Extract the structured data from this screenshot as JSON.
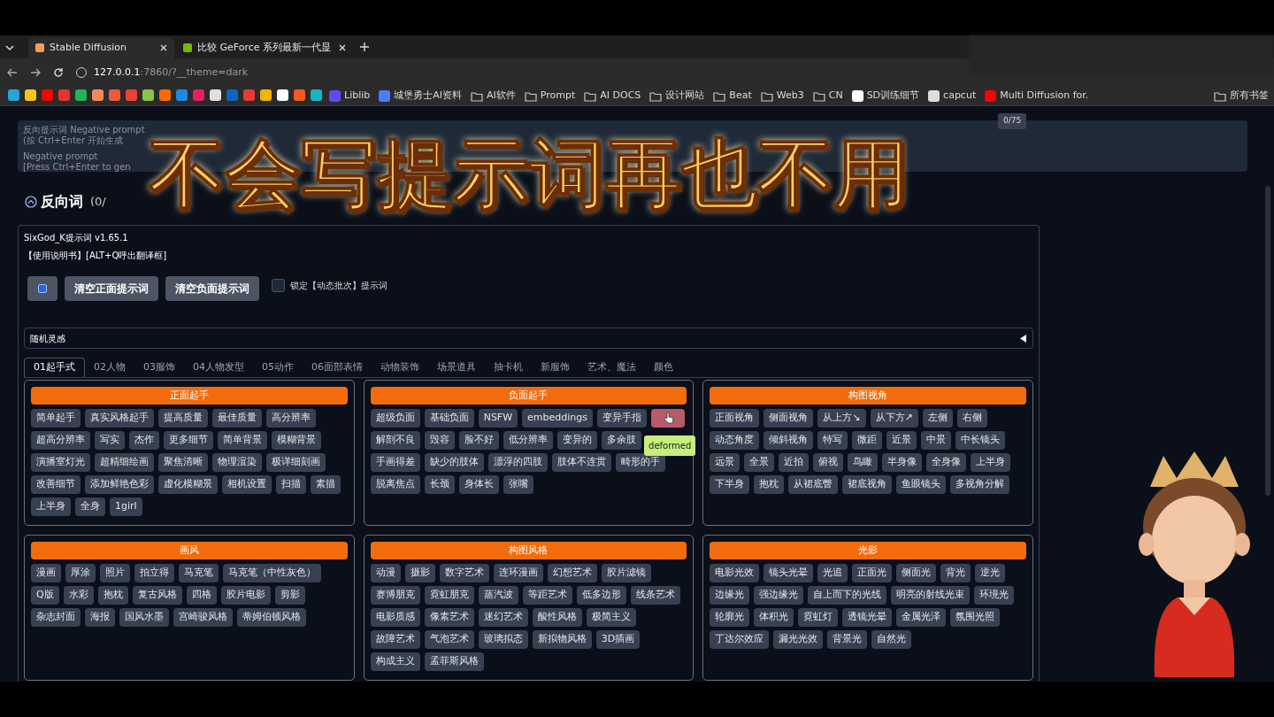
{
  "browser": {
    "tabs": [
      {
        "title": "Stable Diffusion",
        "selected": true
      },
      {
        "title": "比较 GeForce 系列最新一代显",
        "selected": false
      }
    ],
    "address": {
      "host": "127.0.0.1",
      "rest": ":7860/?__theme=dark"
    },
    "bookmarks": [
      {
        "kind": "icon",
        "color": "#29a3d8"
      },
      {
        "kind": "icon",
        "color": "#f5c518"
      },
      {
        "kind": "icon",
        "color": "#ff0000"
      },
      {
        "kind": "icon",
        "color": "#e5352b"
      },
      {
        "kind": "icon",
        "color": "#22b455"
      },
      {
        "kind": "icon",
        "color": "#f08a5d"
      },
      {
        "kind": "icon",
        "color": "#ef5b3a"
      },
      {
        "kind": "icon",
        "color": "#ea4335"
      },
      {
        "kind": "icon",
        "color": "#8bc34a"
      },
      {
        "kind": "icon",
        "color": "#ff6a00"
      },
      {
        "kind": "icon",
        "color": "#1e88e5"
      },
      {
        "kind": "icon",
        "color": "#e91e63"
      },
      {
        "kind": "icon",
        "color": "#e0e0e0"
      },
      {
        "kind": "icon",
        "color": "#0a66c2"
      },
      {
        "kind": "icon",
        "color": "#e53935"
      },
      {
        "kind": "icon",
        "color": "#f0b400"
      },
      {
        "kind": "icon",
        "color": "#ffffff"
      },
      {
        "kind": "icon",
        "color": "#ff5722"
      },
      {
        "kind": "icon",
        "color": "#19b3c2"
      },
      {
        "kind": "site",
        "color": "#5b4bff",
        "label": "Liblib"
      },
      {
        "kind": "site",
        "color": "#4f7cff",
        "label": "城堡勇士AI资料"
      },
      {
        "kind": "folder",
        "label": "AI软件"
      },
      {
        "kind": "folder",
        "label": "Prompt"
      },
      {
        "kind": "folder",
        "label": "AI DOCS"
      },
      {
        "kind": "folder",
        "label": "设计网站"
      },
      {
        "kind": "folder",
        "label": "Beat"
      },
      {
        "kind": "folder",
        "label": "Web3"
      },
      {
        "kind": "folder",
        "label": "CN"
      },
      {
        "kind": "site",
        "color": "#ffffff",
        "label": "SD训练细节"
      },
      {
        "kind": "site",
        "color": "#dddddd",
        "label": "capcut"
      },
      {
        "kind": "site",
        "color": "#ff0000",
        "label": "Multi Diffusion for."
      }
    ],
    "all_bookmarks": "所有书签"
  },
  "negative_prompt": {
    "placeholder_lines": [
      "反向提示词 Negative prompt",
      "(按 Ctrl+Enter 开始生成",
      "Negative prompt",
      "[Press Ctrl+Enter to gen"
    ],
    "counter": "0/75"
  },
  "section_heading": "反向词",
  "section_count": "(0/",
  "overlay_title": "不会写提示词再也不用",
  "plugin": {
    "version": "SixGod_K提示词 v1.65.1",
    "manual": "【使用说明书】[ALT+Q呼出翻译框]",
    "clear_positive": "清空正面提示词",
    "clear_negative": "清空负面提示词",
    "lock": {
      "label": "锁定【动态批次】提示词",
      "checked": false
    },
    "random": {
      "label": "随机灵感",
      "expanded": false
    },
    "tabs": [
      {
        "label": "01起手式",
        "selected": true
      },
      {
        "label": "02人物",
        "selected": false
      },
      {
        "label": "03服饰",
        "selected": false
      },
      {
        "label": "04人物发型",
        "selected": false
      },
      {
        "label": "05动作",
        "selected": false
      },
      {
        "label": "06面部表情",
        "selected": false
      },
      {
        "label": "动物装饰",
        "selected": false
      },
      {
        "label": "场景道具",
        "selected": false
      },
      {
        "label": "抽卡机",
        "selected": false
      },
      {
        "label": "新服饰",
        "selected": false
      },
      {
        "label": "艺术、魔法",
        "selected": false
      },
      {
        "label": "颜色",
        "selected": false
      }
    ],
    "cards": [
      {
        "title": "正面起手",
        "chips": [
          "简单起手",
          "真实风格起手",
          "提高质量",
          "最佳质量",
          "高分辨率",
          "超高分辨率",
          "写实",
          "杰作",
          "更多细节",
          "简单背景",
          "模糊背景",
          "演播室灯光",
          "超精细绘画",
          "聚焦清晰",
          "物理渲染",
          "极详细刻画",
          "改善细节",
          "添加鲜艳色彩",
          "虚化模糊景",
          "相机设置",
          "扫描",
          "素描",
          "上半身",
          "全身",
          "1girl"
        ]
      },
      {
        "title": "负面起手",
        "chips": [
          "超级负面",
          "基础负面",
          "NSFW",
          "embeddings",
          "变异手指",
          {
            "kind": "hovered"
          },
          "解剖不良",
          "毁容",
          "脸不好",
          "低分辨率",
          "变异的",
          "多余肢",
          "手画得差",
          "缺少的肢体",
          "漂浮的四肢",
          "肢体不连贯",
          "畸形的手",
          "脱离焦点",
          "长颈",
          "身体长",
          "张嘴"
        ],
        "tooltip": "deformed"
      },
      {
        "title": "构图视角",
        "chips": [
          "正面视角",
          "侧面视角",
          "从上方↘",
          "从下方↗",
          "左侧",
          "右侧",
          "动态角度",
          "倾斜视角",
          "特写",
          "微距",
          "近景",
          "中景",
          "中长镜头",
          "远景",
          "全景",
          "近拍",
          "俯视",
          "鸟瞰",
          "半身像",
          "全身像",
          "上半身",
          "下半身",
          "抱枕",
          "从裙底瞥",
          "裙底视角",
          "鱼眼镜头",
          "多视角分解"
        ]
      },
      {
        "title": "画风",
        "chips": [
          "漫画",
          "厚涂",
          "照片",
          "拍立得",
          "马克笔",
          "马克笔（中性灰色）",
          "Q版",
          "水彩",
          "抱枕",
          "复古风格",
          "四格",
          "胶片电影",
          "剪影",
          "杂志封面",
          "海报",
          "国风水墨",
          "宫崎骏风格",
          "蒂姆伯顿风格"
        ]
      },
      {
        "title": "构图风格",
        "chips": [
          "动漫",
          "摄影",
          "数字艺术",
          "连环漫画",
          "幻想艺术",
          "胶片滤镜",
          "赛博朋克",
          "霓虹朋克",
          "蒸汽波",
          "等距艺术",
          "低多边形",
          "线条艺术",
          "电影质感",
          "像素艺术",
          "迷幻艺术",
          "酸性风格",
          "极简主义",
          "故障艺术",
          "气泡艺术",
          "玻璃拟态",
          "新拟物风格",
          "3D插画",
          "构成主义",
          "孟菲斯风格"
        ]
      },
      {
        "title": "光影",
        "chips": [
          "电影光效",
          "镜头光晕",
          "光追",
          "正面光",
          "侧面光",
          "背光",
          "逆光",
          "边缘光",
          "强边缘光",
          "自上而下的光线",
          "明亮的射线光束",
          "环境光",
          "轮廓光",
          "体积光",
          "霓虹灯",
          "透镜光晕",
          "金属光泽",
          "氛围光照",
          "丁达尔效应",
          "漏光光效",
          "背景光",
          "自然光"
        ]
      }
    ]
  }
}
